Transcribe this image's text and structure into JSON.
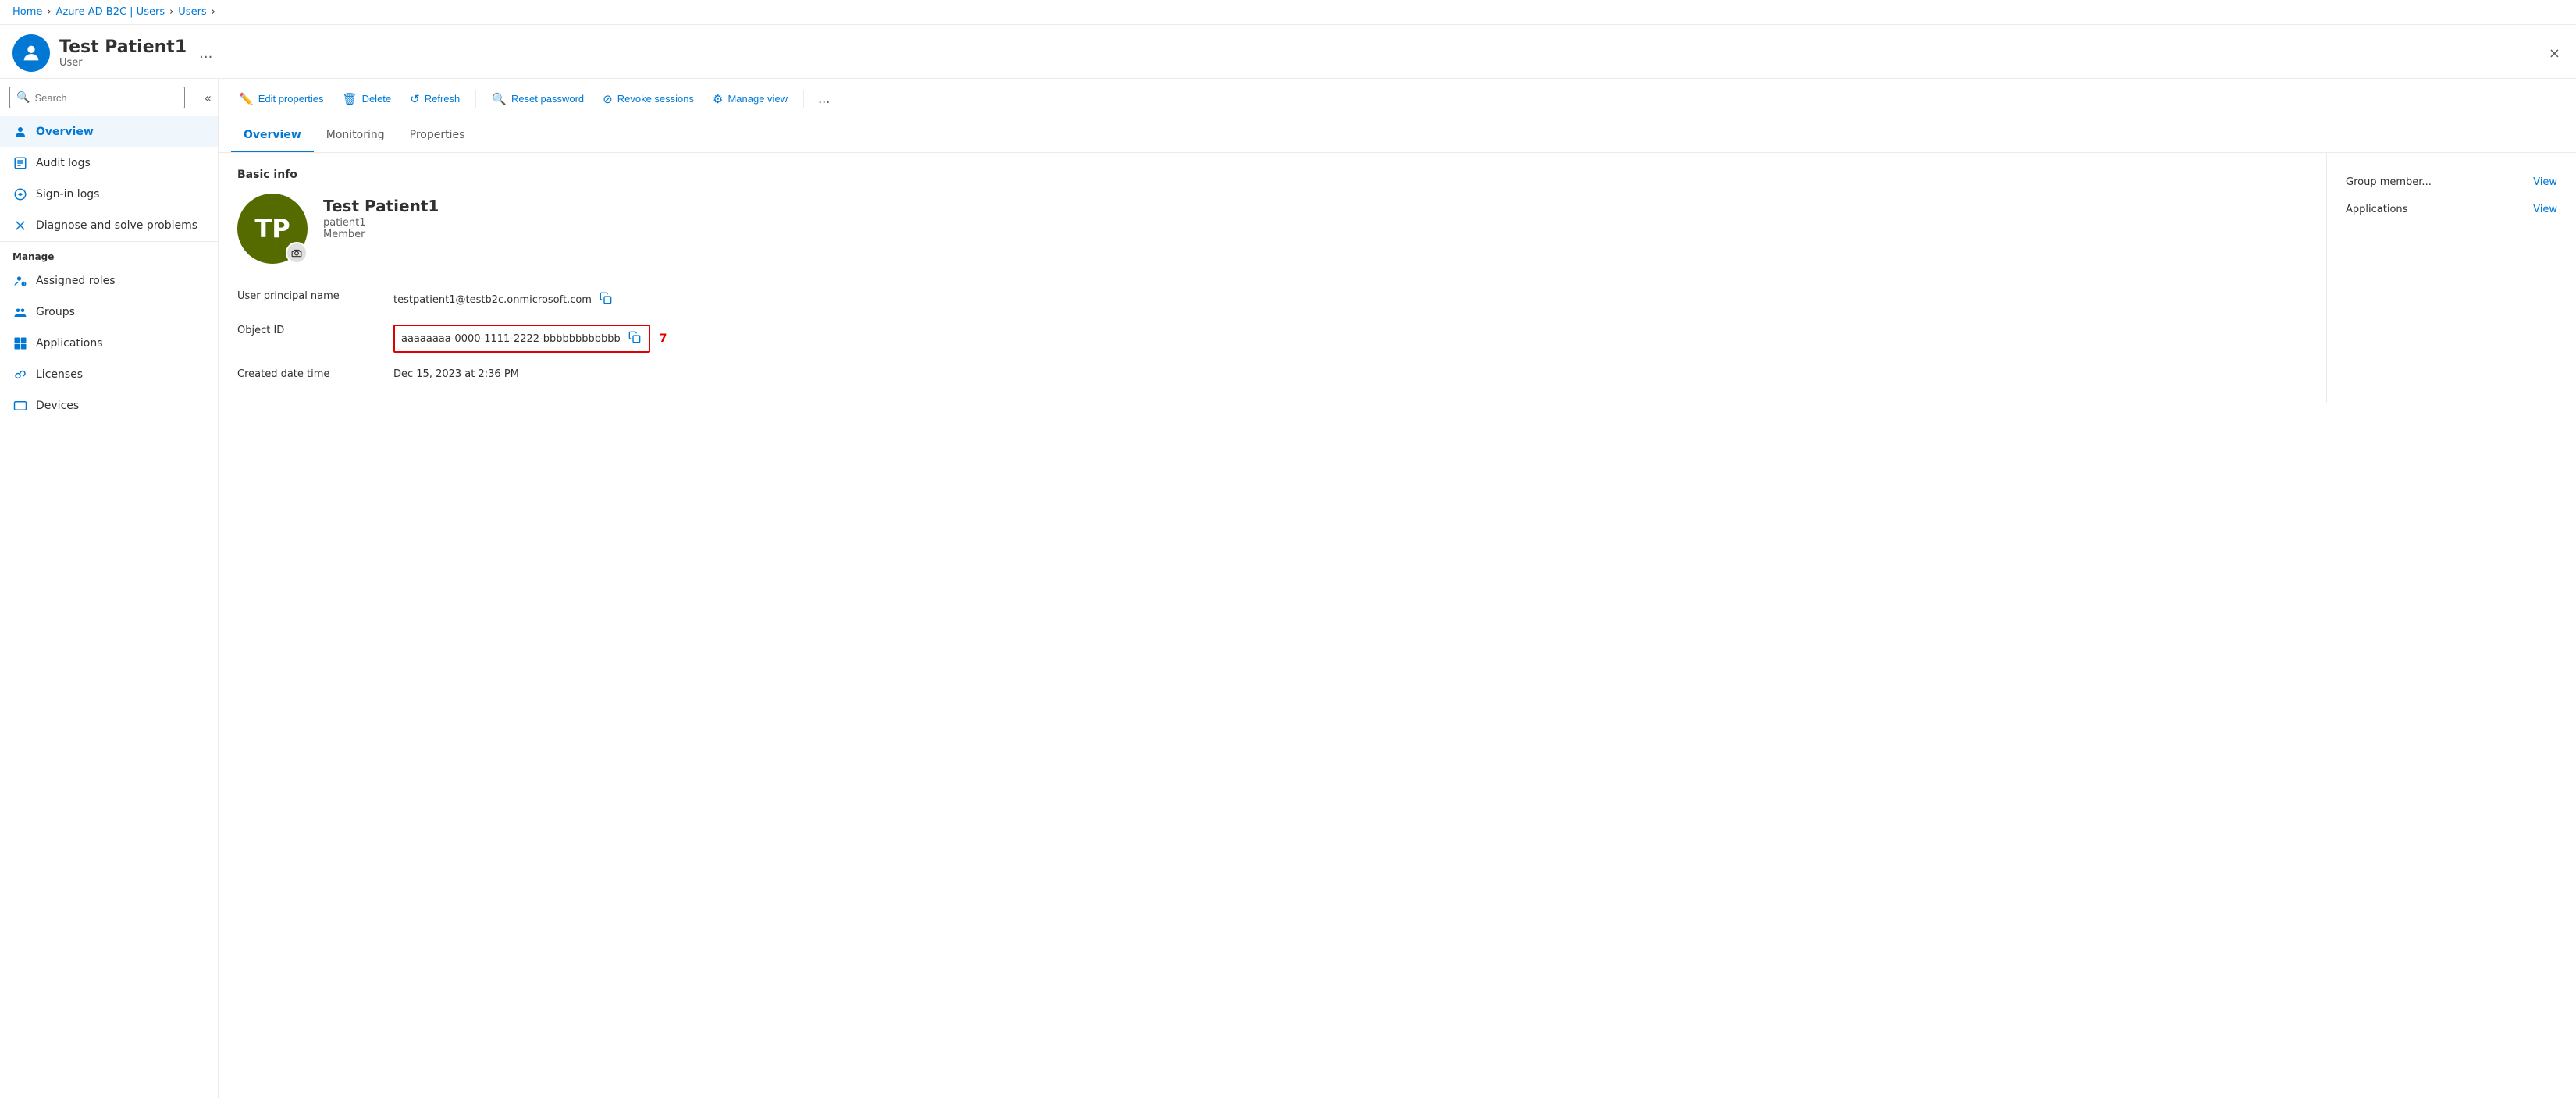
{
  "breadcrumb": {
    "items": [
      "Home",
      "Azure AD B2C | Users",
      "Users"
    ],
    "separators": [
      ">",
      ">",
      ">"
    ]
  },
  "header": {
    "title": "Test Patient1",
    "subtitle": "User",
    "ellipsis": "...",
    "close_label": "×"
  },
  "sidebar": {
    "search_placeholder": "Search",
    "collapse_icon": "«",
    "nav_items": [
      {
        "id": "overview",
        "label": "Overview",
        "active": true
      },
      {
        "id": "audit-logs",
        "label": "Audit logs"
      },
      {
        "id": "sign-in-logs",
        "label": "Sign-in logs"
      },
      {
        "id": "diagnose",
        "label": "Diagnose and solve problems"
      }
    ],
    "manage_label": "Manage",
    "manage_items": [
      {
        "id": "assigned-roles",
        "label": "Assigned roles"
      },
      {
        "id": "groups",
        "label": "Groups"
      },
      {
        "id": "applications",
        "label": "Applications"
      },
      {
        "id": "licenses",
        "label": "Licenses"
      },
      {
        "id": "devices",
        "label": "Devices"
      }
    ]
  },
  "toolbar": {
    "buttons": [
      {
        "id": "edit-properties",
        "label": "Edit properties",
        "icon": "✏️"
      },
      {
        "id": "delete",
        "label": "Delete",
        "icon": "🗑"
      },
      {
        "id": "refresh",
        "label": "Refresh",
        "icon": "↺"
      },
      {
        "id": "reset-password",
        "label": "Reset password",
        "icon": "🔍"
      },
      {
        "id": "revoke-sessions",
        "label": "Revoke sessions",
        "icon": "⊘"
      },
      {
        "id": "manage-view",
        "label": "Manage view",
        "icon": "⚙"
      }
    ],
    "ellipsis": "..."
  },
  "tabs": [
    {
      "id": "overview",
      "label": "Overview",
      "active": true
    },
    {
      "id": "monitoring",
      "label": "Monitoring"
    },
    {
      "id": "properties",
      "label": "Properties"
    }
  ],
  "basic_info": {
    "section_title": "Basic info",
    "user_avatar_initials": "TP",
    "user_name": "Test Patient1",
    "username": "patient1",
    "user_role": "Member",
    "fields": [
      {
        "label": "User principal name",
        "value": "testpatient1@testb2c.onmicrosoft.com",
        "copyable": true,
        "highlighted": false
      },
      {
        "label": "Object ID",
        "value": "aaaaaaaa-0000-1111-2222-bbbbbbbbbbbb",
        "copyable": true,
        "highlighted": true,
        "red_number": "7"
      },
      {
        "label": "Created date time",
        "value": "Dec 15, 2023 at 2:36 PM",
        "copyable": false,
        "highlighted": false
      }
    ]
  },
  "right_panel": {
    "rows": [
      {
        "label": "Group member...",
        "link_text": "View"
      },
      {
        "label": "Applications",
        "link_text": "View"
      }
    ]
  }
}
